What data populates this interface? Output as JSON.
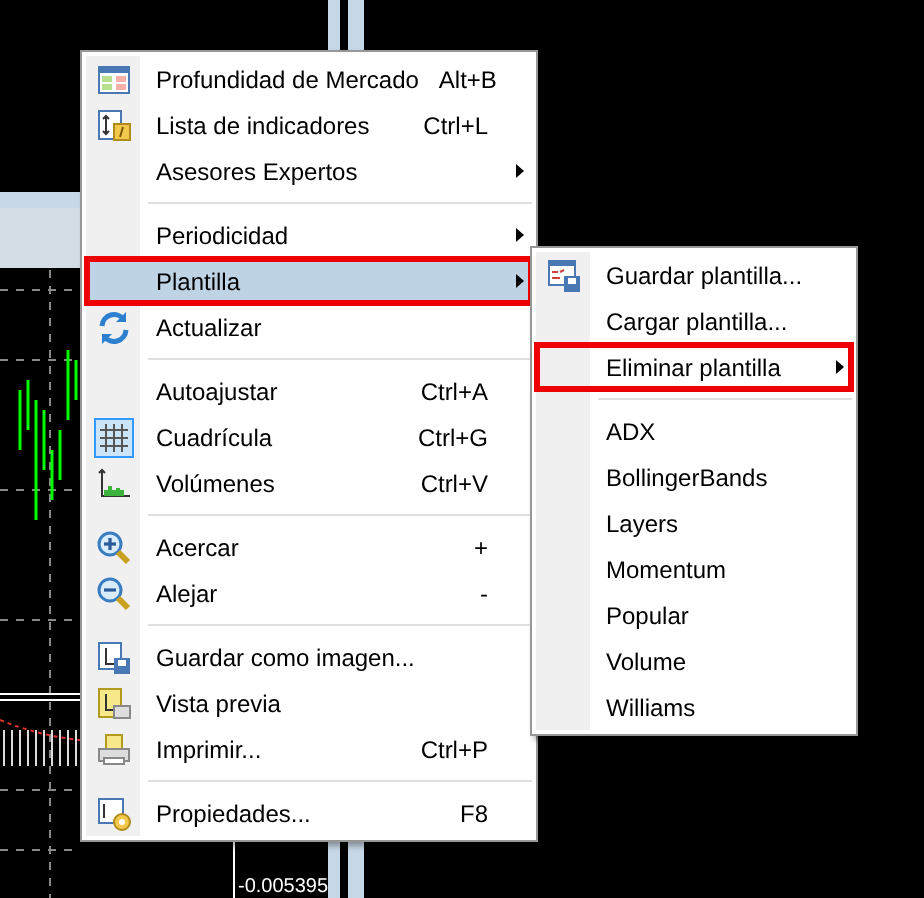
{
  "chart": {
    "price_label": "-0.005395"
  },
  "context_menu": {
    "items": [
      {
        "kind": "item",
        "label": "Profundidad de Mercado",
        "shortcut": "Alt+B",
        "submenu": false,
        "selected": false,
        "marked": false
      },
      {
        "kind": "item",
        "label": "Lista de indicadores",
        "shortcut": "Ctrl+L",
        "submenu": false,
        "selected": false,
        "marked": false
      },
      {
        "kind": "item",
        "label": "Asesores Expertos",
        "submenu": true,
        "selected": false,
        "marked": false
      },
      {
        "kind": "separator"
      },
      {
        "kind": "item",
        "label": "Periodicidad",
        "submenu": true,
        "selected": false,
        "marked": false
      },
      {
        "kind": "item",
        "label": "Plantilla",
        "submenu": true,
        "selected": true,
        "marked": true
      },
      {
        "kind": "item",
        "label": "Actualizar",
        "submenu": false,
        "selected": false,
        "marked": false
      },
      {
        "kind": "separator"
      },
      {
        "kind": "item",
        "label": "Autoajustar",
        "shortcut": "Ctrl+A",
        "submenu": false,
        "selected": false,
        "marked": false
      },
      {
        "kind": "item",
        "label": "Cuadrícula",
        "shortcut": "Ctrl+G",
        "submenu": false,
        "selected": false,
        "checked": true,
        "marked": false
      },
      {
        "kind": "item",
        "label": "Volúmenes",
        "shortcut": "Ctrl+V",
        "submenu": false,
        "selected": false,
        "marked": false
      },
      {
        "kind": "separator"
      },
      {
        "kind": "item",
        "label": "Acercar",
        "shortcut": "+",
        "submenu": false,
        "selected": false,
        "marked": false
      },
      {
        "kind": "item",
        "label": "Alejar",
        "shortcut": "-",
        "submenu": false,
        "selected": false,
        "marked": false
      },
      {
        "kind": "separator"
      },
      {
        "kind": "item",
        "label": "Guardar como imagen...",
        "submenu": false,
        "selected": false,
        "marked": false
      },
      {
        "kind": "item",
        "label": "Vista previa",
        "submenu": false,
        "selected": false,
        "marked": false
      },
      {
        "kind": "item",
        "label": "Imprimir...",
        "shortcut": "Ctrl+P",
        "submenu": false,
        "selected": false,
        "marked": false
      },
      {
        "kind": "separator"
      },
      {
        "kind": "item",
        "label": "Propiedades...",
        "shortcut": "F8",
        "submenu": false,
        "selected": false,
        "marked": false
      }
    ]
  },
  "submenu": {
    "items": [
      {
        "kind": "item",
        "label": "Guardar plantilla...",
        "submenu": false,
        "selected": false,
        "marked": false
      },
      {
        "kind": "item",
        "label": "Cargar plantilla...",
        "submenu": false,
        "selected": false,
        "marked": false
      },
      {
        "kind": "item",
        "label": "Eliminar plantilla",
        "submenu": true,
        "selected": false,
        "marked": true
      },
      {
        "kind": "separator"
      },
      {
        "kind": "item",
        "label": "ADX",
        "submenu": false,
        "selected": false,
        "marked": false
      },
      {
        "kind": "item",
        "label": "BollingerBands",
        "submenu": false,
        "selected": false,
        "marked": false
      },
      {
        "kind": "item",
        "label": "Layers",
        "submenu": false,
        "selected": false,
        "marked": false
      },
      {
        "kind": "item",
        "label": "Momentum",
        "submenu": false,
        "selected": false,
        "marked": false
      },
      {
        "kind": "item",
        "label": "Popular",
        "submenu": false,
        "selected": false,
        "marked": false
      },
      {
        "kind": "item",
        "label": "Volume",
        "submenu": false,
        "selected": false,
        "marked": false
      },
      {
        "kind": "item",
        "label": "Williams",
        "submenu": false,
        "selected": false,
        "marked": false
      }
    ]
  }
}
